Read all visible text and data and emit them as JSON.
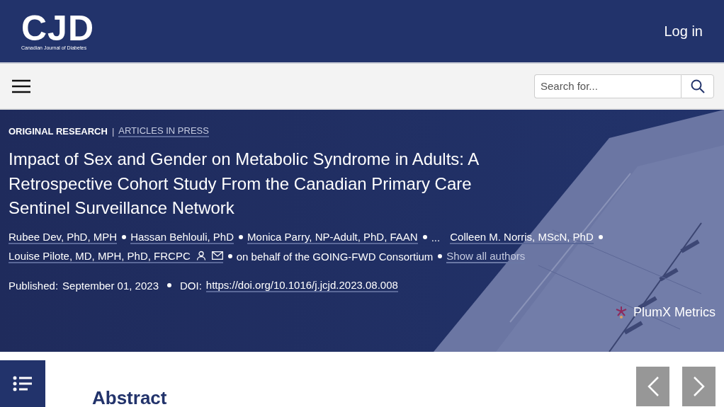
{
  "header": {
    "logo": {
      "mark": "CJD",
      "subtitle": "Canadian Journal of Diabetes"
    },
    "login": "Log in"
  },
  "toolbar": {
    "search": {
      "placeholder": "Search for..."
    }
  },
  "article": {
    "category": "ORIGINAL RESEARCH",
    "separator": "|",
    "section_link": "ARTICLES IN PRESS",
    "title": "Impact of Sex and Gender on Metabolic Syndrome in Adults: A Retrospective Cohort Study From the Canadian Primary Care Sentinel Surveillance Network",
    "authors": [
      {
        "kind": "author",
        "text": "Rubee Dev, PhD, MPH",
        "contact": false
      },
      {
        "kind": "author",
        "text": "Hassan Behlouli, PhD",
        "contact": false
      },
      {
        "kind": "author",
        "text": "Monica Parry, NP-Adult, PhD, FAAN",
        "contact": false
      },
      {
        "kind": "ellipsis",
        "text": "..."
      },
      {
        "kind": "author",
        "text": "Colleen M. Norris, MScN, PhD",
        "contact": false
      },
      {
        "kind": "author",
        "text": "Louise Pilote, MD, MPH, PhD, FRCPC",
        "contact": true
      },
      {
        "kind": "group",
        "text": "on behalf of the GOING-FWD Consortium"
      },
      {
        "kind": "link",
        "text": "Show all authors"
      }
    ],
    "published_label": "Published:",
    "published": "September 01, 2023",
    "doi_label": "DOI:",
    "doi": "https://doi.org/10.1016/j.jcjd.2023.08.008",
    "metrics": "PlumX Metrics"
  },
  "content": {
    "heading": "Abstract"
  }
}
